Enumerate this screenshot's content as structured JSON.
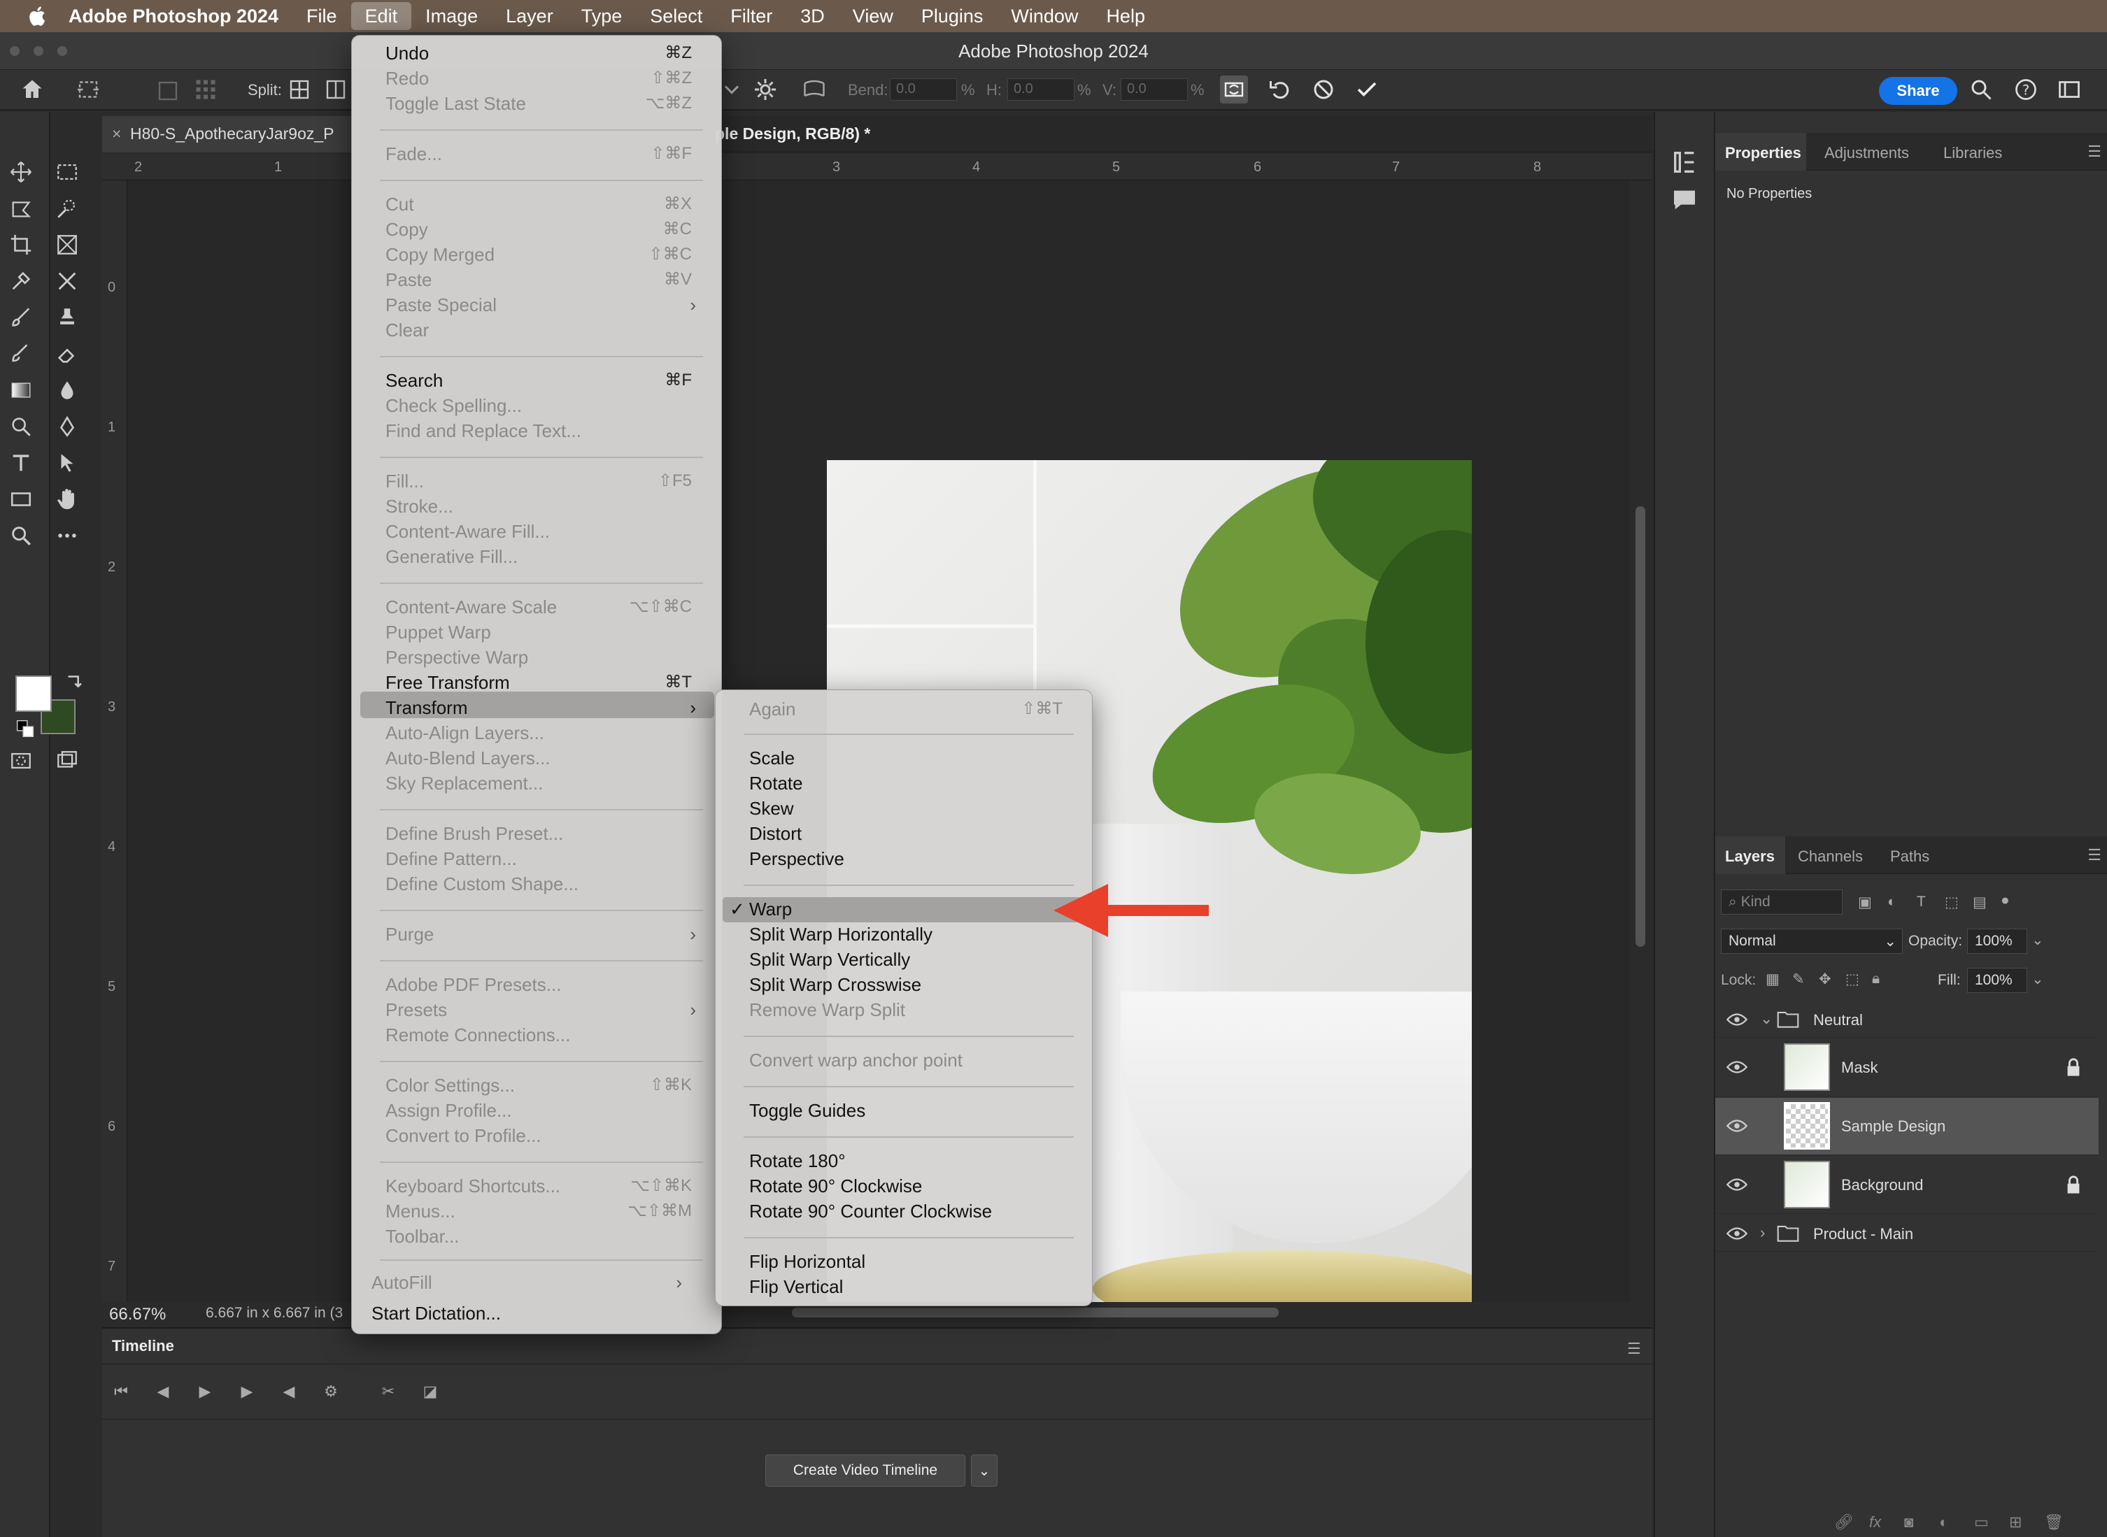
{
  "menubar": {
    "app": "Adobe Photoshop 2024",
    "items": [
      "File",
      "Edit",
      "Image",
      "Layer",
      "Type",
      "Select",
      "Filter",
      "3D",
      "View",
      "Plugins",
      "Window",
      "Help"
    ]
  },
  "window": {
    "title": "Adobe Photoshop 2024"
  },
  "options": {
    "split_label": "Split:",
    "bend_label": "Bend:",
    "bend_value": "0.0",
    "h_label": "H:",
    "h_value": "0.0",
    "v_label": "V:",
    "v_value": "0.0",
    "pct": "%",
    "share": "Share"
  },
  "documents": {
    "tab1": "H80-S_ApothecaryJar9oz_P",
    "tab2": "ple Design, RGB/8) *",
    "close": "×"
  },
  "ruler": {
    "top": [
      "2",
      "1",
      "3",
      "4",
      "5",
      "6",
      "7",
      "8"
    ],
    "left": [
      "0",
      "1",
      "2",
      "3",
      "4",
      "5",
      "6",
      "7"
    ]
  },
  "status": {
    "zoom": "66.67%",
    "doc_info": "6.667 in x 6.667 in (3"
  },
  "timeline": {
    "tab": "Timeline",
    "create_button": "Create Video Timeline"
  },
  "properties": {
    "tabs": [
      "Properties",
      "Adjustments",
      "Libraries"
    ],
    "empty": "No Properties"
  },
  "layers": {
    "tabs": [
      "Layers",
      "Channels",
      "Paths"
    ],
    "filter_placeholder": "Kind",
    "blend_mode": "Normal",
    "opacity_label": "Opacity:",
    "opacity": "100%",
    "lock_label": "Lock:",
    "fill_label": "Fill:",
    "fill": "100%",
    "rows": [
      {
        "name": "Neutral",
        "type": "group",
        "expanded": true
      },
      {
        "name": "Mask",
        "type": "layer",
        "locked": true
      },
      {
        "name": "Sample Design",
        "type": "smart-object",
        "selected": true
      },
      {
        "name": "Background",
        "type": "layer",
        "locked": true
      },
      {
        "name": "Product - Main",
        "type": "group",
        "expanded": false
      }
    ]
  },
  "edit_menu": {
    "undo": "Undo",
    "undo_sc": "⌘Z",
    "redo": "Redo",
    "redo_sc": "⇧⌘Z",
    "toggle_last": "Toggle Last State",
    "toggle_last_sc": "⌥⌘Z",
    "fade": "Fade...",
    "fade_sc": "⇧⌘F",
    "cut": "Cut",
    "cut_sc": "⌘X",
    "copy": "Copy",
    "copy_sc": "⌘C",
    "copy_merged": "Copy Merged",
    "copy_merged_sc": "⇧⌘C",
    "paste": "Paste",
    "paste_sc": "⌘V",
    "paste_special": "Paste Special",
    "clear": "Clear",
    "search": "Search",
    "search_sc": "⌘F",
    "check_spelling": "Check Spelling...",
    "find_replace": "Find and Replace Text...",
    "fill": "Fill...",
    "fill_sc": "⇧F5",
    "stroke": "Stroke...",
    "content_aware_fill": "Content-Aware Fill...",
    "generative_fill": "Generative Fill...",
    "content_aware_scale": "Content-Aware Scale",
    "content_aware_scale_sc": "⌥⇧⌘C",
    "puppet_warp": "Puppet Warp",
    "perspective_warp": "Perspective Warp",
    "free_transform": "Free Transform",
    "free_transform_sc": "⌘T",
    "transform": "Transform",
    "auto_align": "Auto-Align Layers...",
    "auto_blend": "Auto-Blend Layers...",
    "sky_replacement": "Sky Replacement...",
    "define_brush": "Define Brush Preset...",
    "define_pattern": "Define Pattern...",
    "define_shape": "Define Custom Shape...",
    "purge": "Purge",
    "pdf_presets": "Adobe PDF Presets...",
    "presets": "Presets",
    "remote_connections": "Remote Connections...",
    "color_settings": "Color Settings...",
    "color_settings_sc": "⇧⌘K",
    "assign_profile": "Assign Profile...",
    "convert_profile": "Convert to Profile...",
    "keyboard_shortcuts": "Keyboard Shortcuts...",
    "keyboard_shortcuts_sc": "⌥⇧⌘K",
    "menus": "Menus...",
    "menus_sc": "⌥⇧⌘M",
    "toolbar": "Toolbar...",
    "autofill": "AutoFill",
    "dictation": "Start Dictation..."
  },
  "transform_menu": {
    "again": "Again",
    "again_sc": "⇧⌘T",
    "scale": "Scale",
    "rotate": "Rotate",
    "skew": "Skew",
    "distort": "Distort",
    "perspective": "Perspective",
    "warp": "Warp",
    "warp_check": "✓",
    "split_h": "Split Warp Horizontally",
    "split_v": "Split Warp Vertically",
    "split_cross": "Split Warp Crosswise",
    "remove_split": "Remove Warp Split",
    "convert_anchor": "Convert warp anchor point",
    "toggle_guides": "Toggle Guides",
    "rot180": "Rotate 180°",
    "rot90cw": "Rotate 90° Clockwise",
    "rot90ccw": "Rotate 90° Counter Clockwise",
    "flip_h": "Flip Horizontal",
    "flip_v": "Flip Vertical"
  },
  "colors": {
    "menubar": "#6b5a4c",
    "accent": "#1473e6",
    "annotation_arrow": "#e8402a",
    "background_swatch": "#2f4a22",
    "foreground_swatch": "#ffffff"
  }
}
